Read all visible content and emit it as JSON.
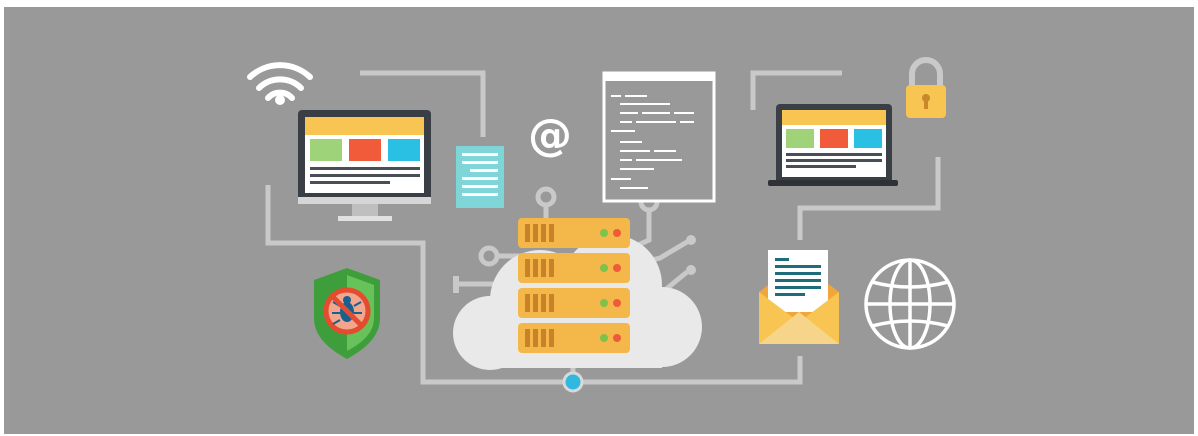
{
  "scene": {
    "at_symbol": "@",
    "background_color": "#999999",
    "line_color": "#c9c9c9",
    "server_color": "#f4b84a",
    "cloud_color": "#e9e9e9",
    "accent_teal": "#7fd6d8",
    "accent_blue": "#29c0e3",
    "accent_red": "#f25b3a",
    "accent_green": "#9fd37a",
    "accent_yellow": "#f8c552"
  },
  "icons": [
    "wifi-icon",
    "desktop-monitor-icon",
    "document-icon",
    "at-sign-icon",
    "code-window-icon",
    "laptop-icon",
    "padlock-icon",
    "shield-bug-icon",
    "server-stack-icon",
    "cloud-icon",
    "envelope-letter-icon",
    "globe-icon"
  ]
}
